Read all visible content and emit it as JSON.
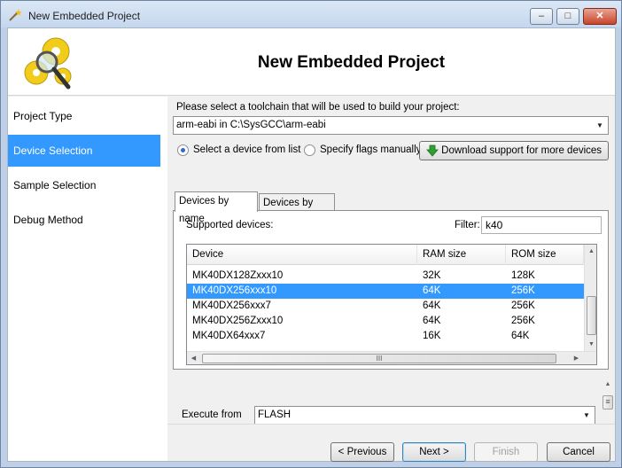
{
  "window": {
    "title": "New Embedded Project",
    "controls": {
      "minimize": "–",
      "maximize": "□",
      "close": "✕"
    }
  },
  "header": {
    "title": "New Embedded Project",
    "icon": "gears-magnifier-icon"
  },
  "sidebar": {
    "items": [
      {
        "label": "Project Type",
        "active": false
      },
      {
        "label": "Device Selection",
        "active": true
      },
      {
        "label": "Sample Selection",
        "active": false
      },
      {
        "label": "Debug Method",
        "active": false
      }
    ]
  },
  "toolchain": {
    "prompt": "Please select a toolchain that will be used to build your project:",
    "selected": "arm-eabi in C:\\SysGCC\\arm-eabi"
  },
  "mode": {
    "option_list": "Select a device from list",
    "option_flags": "Specify flags manually",
    "selected": "list",
    "download_button": "Download support for more devices"
  },
  "tabs": [
    {
      "label": "Devices by name",
      "active": true
    },
    {
      "label": "Devices by type",
      "active": false
    }
  ],
  "devices": {
    "supported_label": "Supported devices:",
    "filter_label": "Filter:",
    "filter_value": "k40",
    "columns": [
      "Device",
      "RAM size",
      "ROM size"
    ],
    "rows": [
      {
        "device": "MK40DX128Zxxx10",
        "ram": "32K",
        "rom": "128K",
        "selected": false
      },
      {
        "device": "MK40DX256xxx10",
        "ram": "64K",
        "rom": "256K",
        "selected": true
      },
      {
        "device": "MK40DX256xxx7",
        "ram": "64K",
        "rom": "256K",
        "selected": false
      },
      {
        "device": "MK40DX256Zxxx10",
        "ram": "64K",
        "rom": "256K",
        "selected": false
      },
      {
        "device": "MK40DX64xxx7",
        "ram": "16K",
        "rom": "64K",
        "selected": false
      }
    ],
    "hscroll_grip": "III"
  },
  "execute": {
    "label": "Execute from",
    "selected": "FLASH",
    "grip": "≡"
  },
  "footer": {
    "previous": "< Previous",
    "next": "Next >",
    "finish": "Finish",
    "cancel": "Cancel"
  },
  "colors": {
    "selection": "#3399ff",
    "download_arrow": "#2fa02f"
  }
}
